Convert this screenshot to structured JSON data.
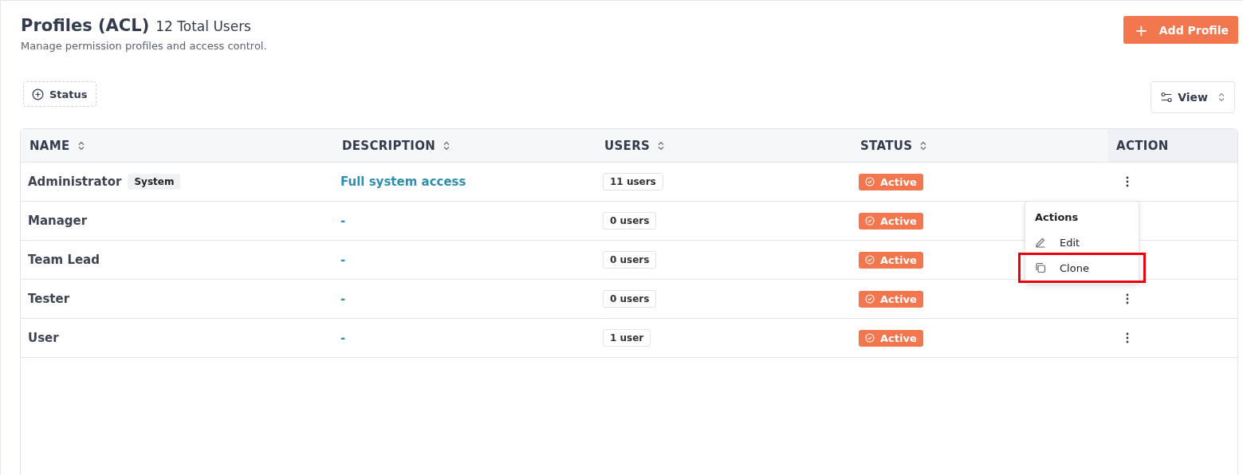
{
  "header": {
    "title": "Profiles (ACL)",
    "count": "12 Total Users",
    "subtitle": "Manage permission profiles and access control.",
    "add_button": "Add Profile",
    "add_icon": "+"
  },
  "filters": [
    {
      "label": "Status"
    }
  ],
  "view_button": {
    "label": "View"
  },
  "table": {
    "columns": [
      {
        "label": "NAME",
        "sortable": true
      },
      {
        "label": "DESCRIPTION",
        "sortable": true
      },
      {
        "label": "USERS",
        "sortable": true
      },
      {
        "label": "STATUS",
        "sortable": true
      },
      {
        "label": "ACTION",
        "sortable": false
      }
    ],
    "rows": [
      {
        "name": "Administrator",
        "tag": "System",
        "description": "Full system access",
        "users": "11 users",
        "status": "Active"
      },
      {
        "name": "Manager",
        "description": "-",
        "users": "0 users",
        "status": "Active"
      },
      {
        "name": "Team Lead",
        "description": "-",
        "users": "0 users",
        "status": "Active"
      },
      {
        "name": "Tester",
        "description": "-",
        "users": "0 users",
        "status": "Active"
      },
      {
        "name": "User",
        "description": "-",
        "users": "1 user",
        "status": "Active"
      }
    ]
  },
  "action_menu": {
    "title": "Actions",
    "items": [
      {
        "label": "Edit",
        "kind": "edit",
        "highlighted": false
      },
      {
        "label": "Clone",
        "kind": "clone",
        "highlighted": true
      }
    ]
  }
}
